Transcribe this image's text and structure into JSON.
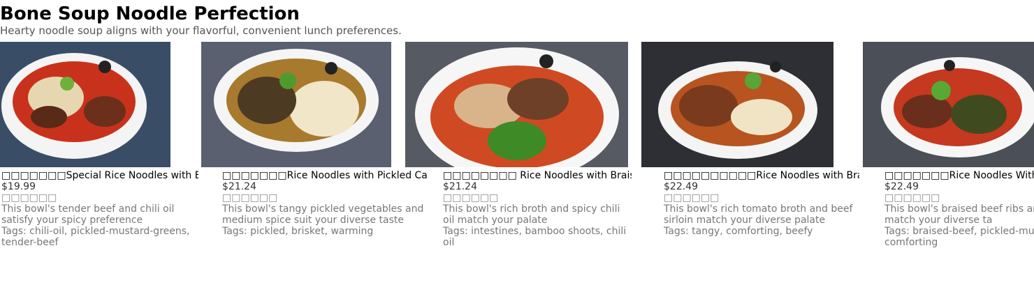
{
  "header": {
    "title": "Bone Soup Noodle Perfection",
    "subtitle": "Hearty noodle soup aligns with your flavorful, convenient lunch preferences."
  },
  "cards": [
    {
      "name": "□□□□□□□Special Rice Noodles with Be",
      "price": "$19.99",
      "name_cn": "□□□□□□",
      "description": "This bowl's tender beef and chili oil satisfy your spicy preference",
      "tags": "Tags: chili-oil, pickled-mustard-greens, tender-beef",
      "image_icon": "noodle-bowl-photo"
    },
    {
      "name": "□□□□□□□Rice Noodles with Pickled Ca",
      "price": "$21.24",
      "name_cn": "□□□□□□",
      "description": "This bowl's tangy pickled vegetables and medium spice suit your diverse taste",
      "tags": "Tags: pickled, brisket, warming",
      "image_icon": "noodle-bowl-photo"
    },
    {
      "name": "□□□□□□□□ Rice Noodles with Braised",
      "price": "$21.24",
      "name_cn": "□□□□□□",
      "description": "This bowl's rich broth and spicy chili oil match your palate",
      "tags": "Tags: intestines, bamboo shoots, chili oil",
      "image_icon": "noodle-bowl-photo"
    },
    {
      "name": "□□□□□□□□□□Rice Noodles with Braised",
      "price": "$22.49",
      "name_cn": "□□□□□□",
      "description": "This bowl's rich tomato broth and beef sirloin match your diverse palate",
      "tags": "Tags: tangy, comforting, beefy",
      "image_icon": "noodle-bowl-photo"
    },
    {
      "name": "□□□□□□□Rice Noodles With Bra",
      "price": "$22.49",
      "name_cn": "□□□□□□",
      "description": "This bowl's braised beef ribs and mustard match your diverse ta",
      "tags": "Tags: braised-beef, pickled-mu comforting",
      "image_icon": "noodle-bowl-photo"
    }
  ]
}
